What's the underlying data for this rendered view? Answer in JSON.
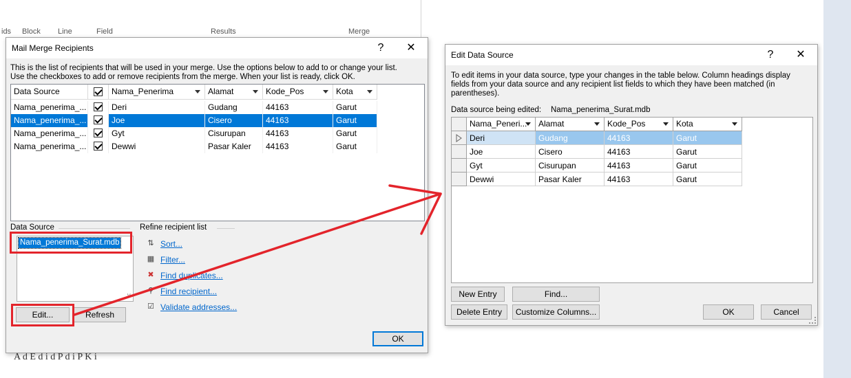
{
  "background": {
    "ribbon_fragments": [
      "ids",
      "Block",
      "Line",
      "Field",
      "Results",
      "Merge"
    ],
    "footer_text": "A        d          E  d      i  d     P  d    i     P           K  i"
  },
  "mmr": {
    "title": "Mail Merge Recipients",
    "help_label": "?",
    "close_label": "✕",
    "intro_line1": "This is the list of recipients that will be used in your merge.  Use the options below to add to or change your list.",
    "intro_line2": "Use the checkboxes to add or remove recipients from the merge.  When your list is ready, click OK.",
    "columns": [
      "Data Source",
      "",
      "Nama_Penerima",
      "Alamat",
      "Kode_Pos",
      "Kota"
    ],
    "rows": [
      {
        "source": "Nama_penerima_...",
        "nama": "Deri",
        "alamat": "Gudang",
        "kode_pos": "44163",
        "kota": "Garut",
        "checked": true,
        "selected": false
      },
      {
        "source": "Nama_penerima_...",
        "nama": "Joe",
        "alamat": "Cisero",
        "kode_pos": "44163",
        "kota": "Garut",
        "checked": true,
        "selected": true
      },
      {
        "source": "Nama_penerima_...",
        "nama": "Gyt",
        "alamat": "Cisurupan",
        "kode_pos": "44163",
        "kota": "Garut",
        "checked": true,
        "selected": false
      },
      {
        "source": "Nama_penerima_...",
        "nama": "Dewwi",
        "alamat": "Pasar Kaler",
        "kode_pos": "44163",
        "kota": "Garut",
        "checked": true,
        "selected": false
      }
    ],
    "data_source_label": "Data Source",
    "data_source_item": "Nama_penerima_Surat.mdb",
    "refine_label": "Refine recipient list",
    "refine_items": [
      {
        "label": "Sort...",
        "icon": "sort-icon"
      },
      {
        "label": "Filter...",
        "icon": "filter-icon"
      },
      {
        "label": "Find duplicates...",
        "icon": "find-duplicates-icon"
      },
      {
        "label": "Find recipient...",
        "icon": "find-recipient-icon"
      },
      {
        "label": "Validate addresses...",
        "icon": "validate-addresses-icon"
      }
    ],
    "edit_button": "Edit...",
    "refresh_button": "Refresh",
    "ok_button": "OK"
  },
  "eds": {
    "title": "Edit Data Source",
    "help_label": "?",
    "close_label": "✕",
    "intro_line1": "To edit items in your data source, type your changes in the table below. Column headings display",
    "intro_line2": "fields from your data source and any recipient list fields to which they have been matched (in",
    "intro_line3": "parentheses).",
    "being_edited_label": "Data source being edited:",
    "being_edited_value": "Nama_penerima_Surat.mdb",
    "columns": [
      "Nama_Peneri...",
      "Alamat",
      "Kode_Pos",
      "Kota"
    ],
    "rows": [
      {
        "nama": "Deri",
        "alamat": "Gudang",
        "kode_pos": "44163",
        "kota": "Garut",
        "current": true
      },
      {
        "nama": "Joe",
        "alamat": "Cisero",
        "kode_pos": "44163",
        "kota": "Garut",
        "current": false
      },
      {
        "nama": "Gyt",
        "alamat": "Cisurupan",
        "kode_pos": "44163",
        "kota": "Garut",
        "current": false
      },
      {
        "nama": "Dewwi",
        "alamat": "Pasar Kaler",
        "kode_pos": "44163",
        "kota": "Garut",
        "current": false
      }
    ],
    "new_entry_button": "New Entry",
    "find_button": "Find...",
    "delete_entry_button": "Delete Entry",
    "customize_columns_button": "Customize Columns...",
    "ok_button": "OK",
    "cancel_button": "Cancel"
  },
  "colors": {
    "annotation": "#e3242b",
    "selection": "#0078d7",
    "link": "#0066cc"
  }
}
